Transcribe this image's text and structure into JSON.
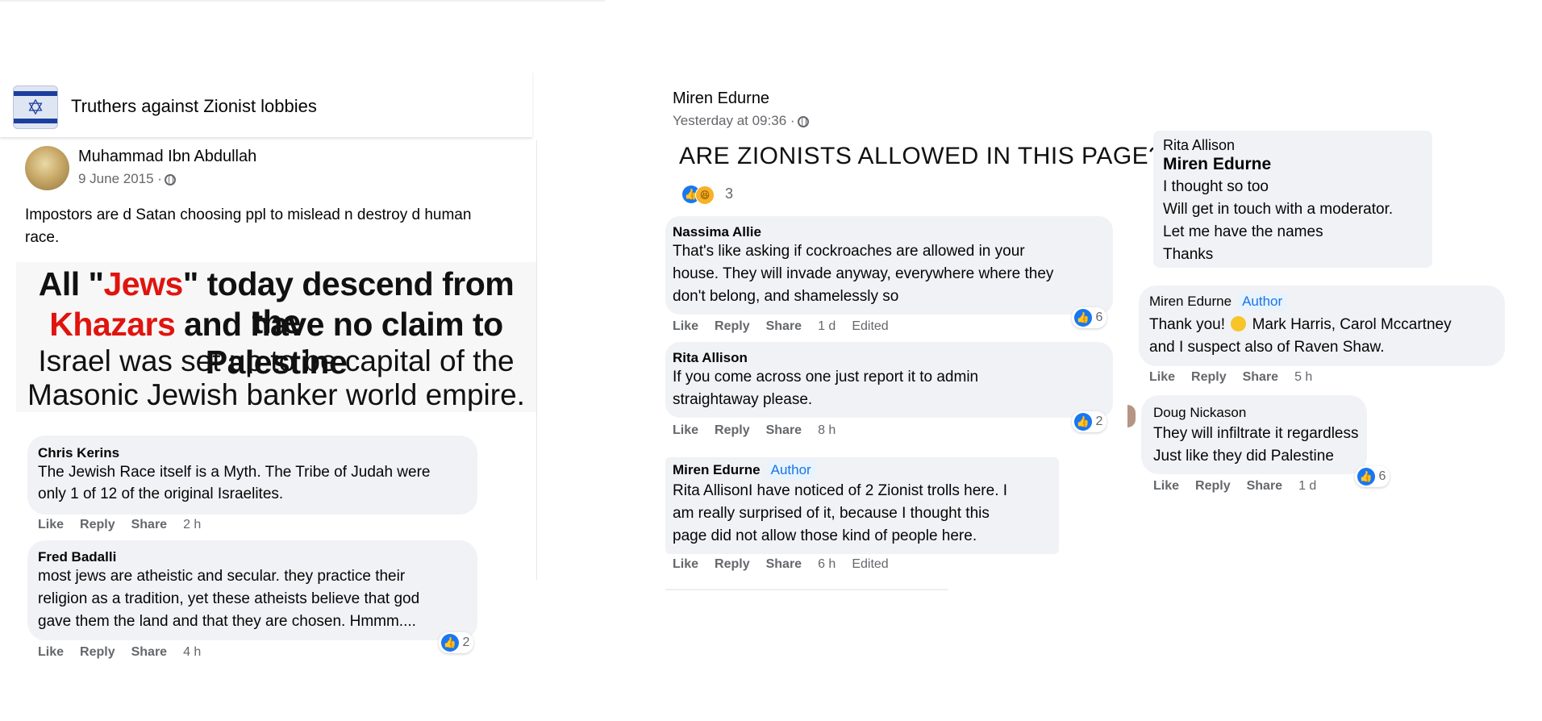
{
  "group": {
    "name": "Truthers against Zionist lobbies"
  },
  "left_post": {
    "author": "Muhammad Ibn Abdullah",
    "date": "9 June 2015 ·",
    "text_line1": "Impostors are d Satan choosing ppl to mislead n destroy d human",
    "text_line2": "race.",
    "meme": {
      "line1_a": "All \"",
      "line1_b": "Jews",
      "line1_c": "\" today descend from the",
      "line2_a": "Khazars",
      "line2_b": " and have no claim to Palestine",
      "line3": "Israel was set up to be capital of the",
      "line4": "Masonic Jewish banker world empire."
    },
    "comments": [
      {
        "author": "Chris Kerins",
        "line1": "The Jewish Race itself is a Myth. The Tribe of Judah were",
        "line2": "only 1 of 12 of the original Israelites.",
        "time": "2 h"
      },
      {
        "author": "Fred Badalli",
        "line1": "most jews are atheistic and secular. they practice their",
        "line2": "religion as a tradition, yet these atheists believe that god",
        "line3": "gave them the land and that they are chosen. Hmmm....",
        "time": "4 h",
        "reactions": "2"
      }
    ]
  },
  "center_post": {
    "author": "Miren Edurne",
    "date": "Yesterday at 09:36 ·",
    "title": "ARE ZIONISTS ALLOWED IN THIS PAGE?",
    "reactions": "3",
    "comments": [
      {
        "author": "Nassima Allie",
        "line1": "That's like asking if cockroaches are allowed in your",
        "line2": "house. They will invade anyway, everywhere where they",
        "line3": "don't belong, and shamelessly so",
        "time": "1 d",
        "edited": "Edited",
        "reactions": "6"
      },
      {
        "author": "Rita Allison",
        "line1": "If you come across one just report it to admin",
        "line2": "straightaway please.",
        "time": "8 h",
        "reactions": "2"
      },
      {
        "author": "Miren Edurne",
        "badge": "Author",
        "line1": "Rita AllisonI have noticed of 2 Zionist trolls here. I",
        "line2": "am really surprised of it, because I thought this",
        "line3": "page did not allow those kind of people here.",
        "time": "6 h",
        "edited": "Edited"
      }
    ]
  },
  "right_thread": {
    "c1": {
      "author": "Rita Allison",
      "mention": "Miren Edurne",
      "line1": "I thought so too",
      "line2": "Will get in touch with a moderator.",
      "line3": "Let me have the names",
      "line4": "Thanks"
    },
    "c2": {
      "author": "Miren Edurne",
      "badge": "Author",
      "line1_a": "Thank you!",
      "line1_b": "Mark Harris, Carol Mccartney",
      "line2": "and I suspect also of Raven Shaw.",
      "time": "5 h"
    },
    "c3": {
      "author": "Doug Nickason",
      "line1": "They will infiltrate it regardless",
      "line2": "Just like they did Palestine",
      "time": "1 d",
      "reactions": "6"
    }
  },
  "actions": {
    "like": "Like",
    "reply": "Reply",
    "share": "Share"
  },
  "colors": {
    "bubble": "#f0f2f5",
    "like_blue": "#1877f2",
    "meme_red": "#e0140e",
    "badge_bg": "#e7f3ff"
  }
}
